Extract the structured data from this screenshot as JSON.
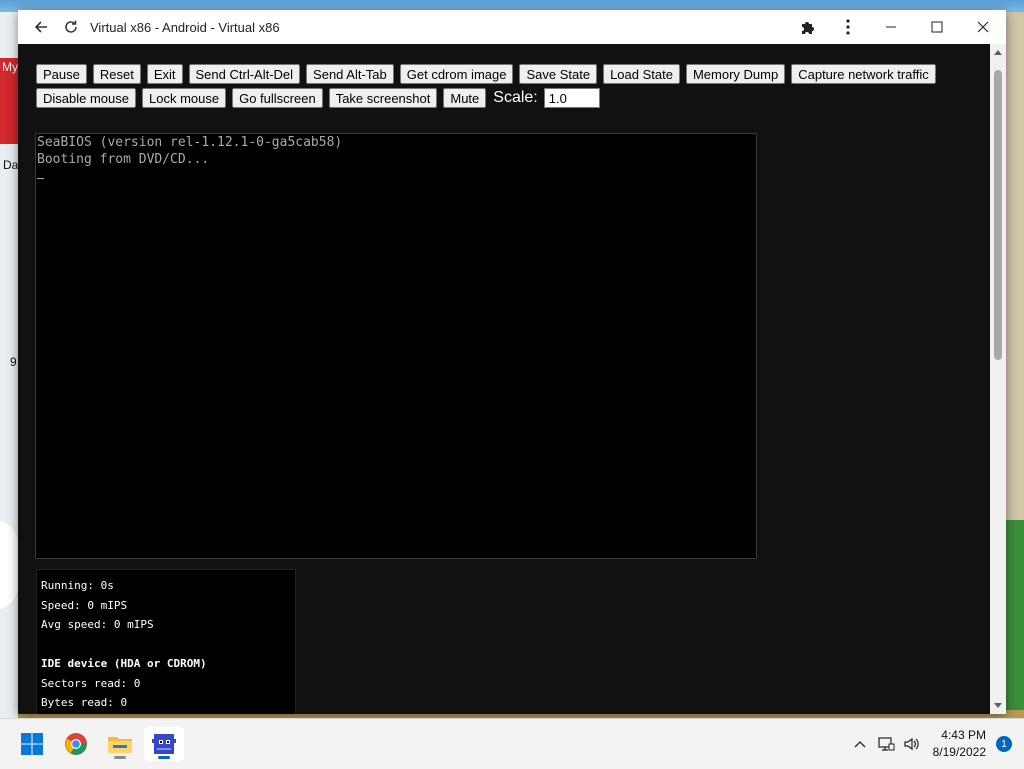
{
  "desktop": {
    "label_my": "My",
    "label_da": "Da",
    "label_9": "9"
  },
  "window": {
    "title": "Virtual x86 - Android - Virtual x86"
  },
  "toolbar": {
    "row1": [
      "Pause",
      "Reset",
      "Exit",
      "Send Ctrl-Alt-Del",
      "Send Alt-Tab",
      "Get cdrom image",
      "Save State",
      "Load State",
      "Memory Dump",
      "Capture network traffic"
    ],
    "row2": [
      "Disable mouse",
      "Lock mouse",
      "Go fullscreen",
      "Take screenshot",
      "Mute"
    ],
    "scale_label": "Scale:",
    "scale_value": "1.0"
  },
  "screen": {
    "lines": [
      "SeaBIOS (version rel-1.12.1-0-ga5cab58)",
      "Booting from DVD/CD..."
    ]
  },
  "stats": {
    "running": "Running: 0s",
    "speed": "Speed: 0 mIPS",
    "avg_speed": "Avg speed: 0 mIPS",
    "ide_header": "IDE device (HDA or CDROM)",
    "sectors_read": "Sectors read: 0",
    "bytes_read": "Bytes read: 0"
  },
  "taskbar": {
    "apps": [
      "windows-start-icon",
      "chrome-icon",
      "file-explorer-icon",
      "virtual-x86-icon"
    ],
    "time": "4:43 PM",
    "date": "8/19/2022",
    "notification_count": "1"
  },
  "colors": {
    "accent": "#0067c0",
    "screen_text": "#aaaaaa",
    "app_bg": "#111111"
  }
}
